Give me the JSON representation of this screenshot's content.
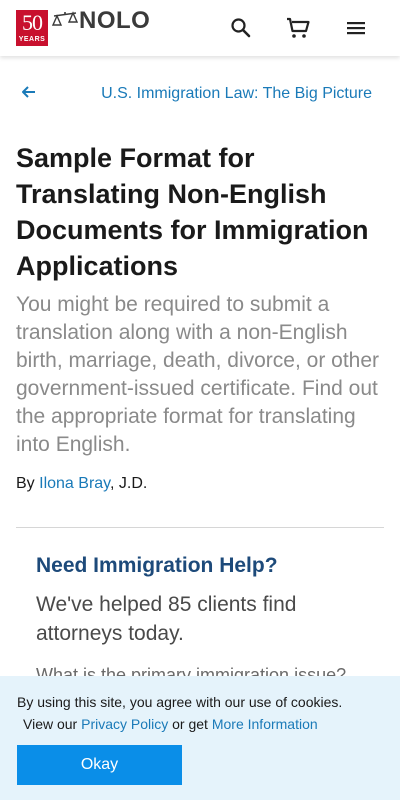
{
  "header": {
    "logo": {
      "badge_number": "50",
      "badge_text": "YEARS",
      "wordmark": "NOLO"
    },
    "icons": [
      "search-icon",
      "cart-icon",
      "menu-icon"
    ]
  },
  "breadcrumb": {
    "back_icon": "arrow-left-icon",
    "label": "U.S. Immigration Law: The Big Picture"
  },
  "article": {
    "title": "Sample Format for Translating Non-English Documents for Immigration Applications",
    "subtitle": "You might be required to submit a translation along with a non-English birth, marriage, death, divorce, or other government-issued certificate. Find out the appropriate format for translating into English.",
    "byline_prefix": "By ",
    "author": "Ilona Bray",
    "author_suffix": ", J.D."
  },
  "help_box": {
    "title": "Need Immigration Help?",
    "subtitle": "We've helped 85 clients find attorneys today.",
    "question": "What is the primary immigration issue?"
  },
  "cookie_banner": {
    "line1": "By using this site, you agree with our use of cookies.",
    "line2_prefix": "View our ",
    "privacy_link": "Privacy Policy",
    "line2_middle": " or get ",
    "info_link": "More Information",
    "button": "Okay"
  },
  "colors": {
    "brand_red": "#c8102e",
    "link_blue": "#1a7ab8",
    "heading_navy": "#1d4a7a",
    "button_blue": "#0a8ee8",
    "banner_bg": "#e5f3fb"
  }
}
